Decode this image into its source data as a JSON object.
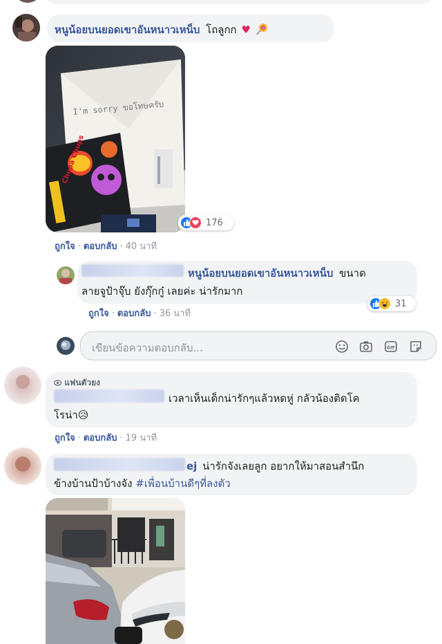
{
  "comment1": {
    "author": "หนูน้อยบนยอดเขาอันหนาวเหน็บ",
    "text": "โถลูกก",
    "emoji": "♥",
    "reaction_count": "176",
    "like_label": "ถูกใจ",
    "reply_label": "ตอบกลับ",
    "time": "40 นาที"
  },
  "reply1": {
    "mention": "หนูน้อยบนยอดเขาอันหนาวเหน็บ",
    "text_line1_rest": "ขนาด",
    "text_line2": "ลายจูป้าจุ๊บ ยังกุ๊กกู๋ เลยค่ะ น่ารักมาก",
    "reaction_count": "31",
    "like_label": "ถูกใจ",
    "reply_label": "ตอบกลับ",
    "time": "36 นาที"
  },
  "reply_input": {
    "placeholder": "เขียนข้อความตอบกลับ..."
  },
  "comment2": {
    "badge": "แฟนตัวยง",
    "text_line1": "เวลาเห็นเด็กน่ารักๆแล้วหดหู่ กลัวน้องติดโค",
    "text_line2": "โรน่า😥",
    "like_label": "ถูกใจ",
    "reply_label": "ตอบกลับ",
    "time": "19 นาที"
  },
  "comment3": {
    "name_tail": "ej",
    "text_line1": "น่ารักจังเลยลูก อยากให้มาสอนสำนึก",
    "text_line2_plain": "ข้างบ้านป้าบ้างจัง ",
    "hashtag": "#เพื่อนบ้านดีๆที่ลงตัว"
  },
  "photo1": {
    "note_text": "I'm sorry ขอโทษครับ",
    "brand": "Chupa Chups"
  }
}
